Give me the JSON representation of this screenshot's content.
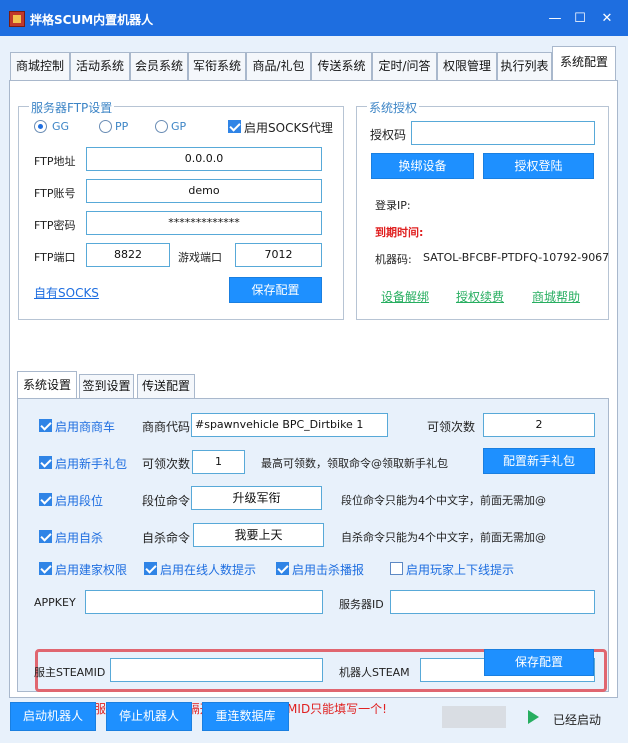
{
  "window": {
    "title": "拌格SCUM内置机器人",
    "minimize": "—",
    "maximize": "☐",
    "close": "✕"
  },
  "tabs": [
    "商城控制",
    "活动系统",
    "会员系统",
    "军衔系统",
    "商品/礼包",
    "传送系统",
    "定时/问答",
    "权限管理",
    "执行列表",
    "系统配置"
  ],
  "ftp": {
    "group_title": "服务器FTP设置",
    "radio_gg": "GG",
    "radio_pp": "PP",
    "radio_gp": "GP",
    "socks_label": "启用SOCKS代理",
    "addr_label": "FTP地址",
    "addr_value": "0.0.0.0",
    "account_label": "FTP账号",
    "account_value": "demo",
    "password_label": "FTP密码",
    "password_value": "*************",
    "port_label": "FTP端口",
    "port_value": "8822",
    "game_port_label": "游戏端口",
    "game_port_value": "7012",
    "own_socks_link": "自有SOCKS",
    "save_button": "保存配置"
  },
  "auth": {
    "group_title": "系统授权",
    "code_label": "授权码",
    "code_value": "",
    "switch_device_button": "换绑设备",
    "login_button": "授权登陆",
    "login_ip_label": "登录IP:",
    "expire_label": "到期时间:",
    "machine_label": "机器码:",
    "machine_value": "SATOL-BFCBF-PTDFQ-10792-9067",
    "unbind_link": "设备解绑",
    "renew_link": "授权续费",
    "help_link": "商城帮助"
  },
  "subtabs": [
    "系统设置",
    "签到设置",
    "传送配置"
  ],
  "system": {
    "trader_label": "启用商商车",
    "trader_code_label": "商商代码",
    "trader_code_value": "#spawnvehicle BPC_Dirtbike  1",
    "trader_times_label": "可领次数",
    "trader_times_value": "2",
    "newbie_label": "启用新手礼包",
    "newbie_times_label": "可领次数",
    "newbie_times_value": "1",
    "newbie_hint": "最高可领数，领取命令@领取新手礼包",
    "newbie_config_button": "配置新手礼包",
    "rank_label": "启用段位",
    "rank_cmd_label": "段位命令",
    "rank_cmd_value": "升级军衔",
    "rank_hint": "段位命令只能为4个中文字，前面无需加@",
    "suicide_label": "启用自杀",
    "suicide_cmd_label": "自杀命令",
    "suicide_cmd_value": "我要上天",
    "suicide_hint": "自杀命令只能为4个中文字，前面无需加@",
    "build_perm_label": "启用建家权限",
    "online_hint_label": "启用在线人数提示",
    "kill_broadcast_label": "启用击杀播报",
    "player_online_label": "启用玩家上下线提示",
    "appkey_label": "APPKEY",
    "appkey_value": "",
    "server_id_label": "服务器ID",
    "server_id_value": "",
    "owner_steam_label": "服主STEAMID",
    "owner_steam_value": "",
    "bot_steam_label": "机器人STEAM",
    "bot_steam_value": "",
    "warning": "在设置多个服主STEAMID用,隔开! 机器人STEAMID只能填写一个!",
    "save_button": "保存配置"
  },
  "bottom": {
    "start_button": "启动机器人",
    "stop_button": "停止机器人",
    "reconnect_button": "重连数据库",
    "status": "已经启动"
  },
  "colors": {
    "titlebar": "#1e6ee0",
    "accent": "#1e90ff",
    "link_green": "#27ae60",
    "warning_red": "#e02020",
    "highlight_border": "#e06670"
  }
}
